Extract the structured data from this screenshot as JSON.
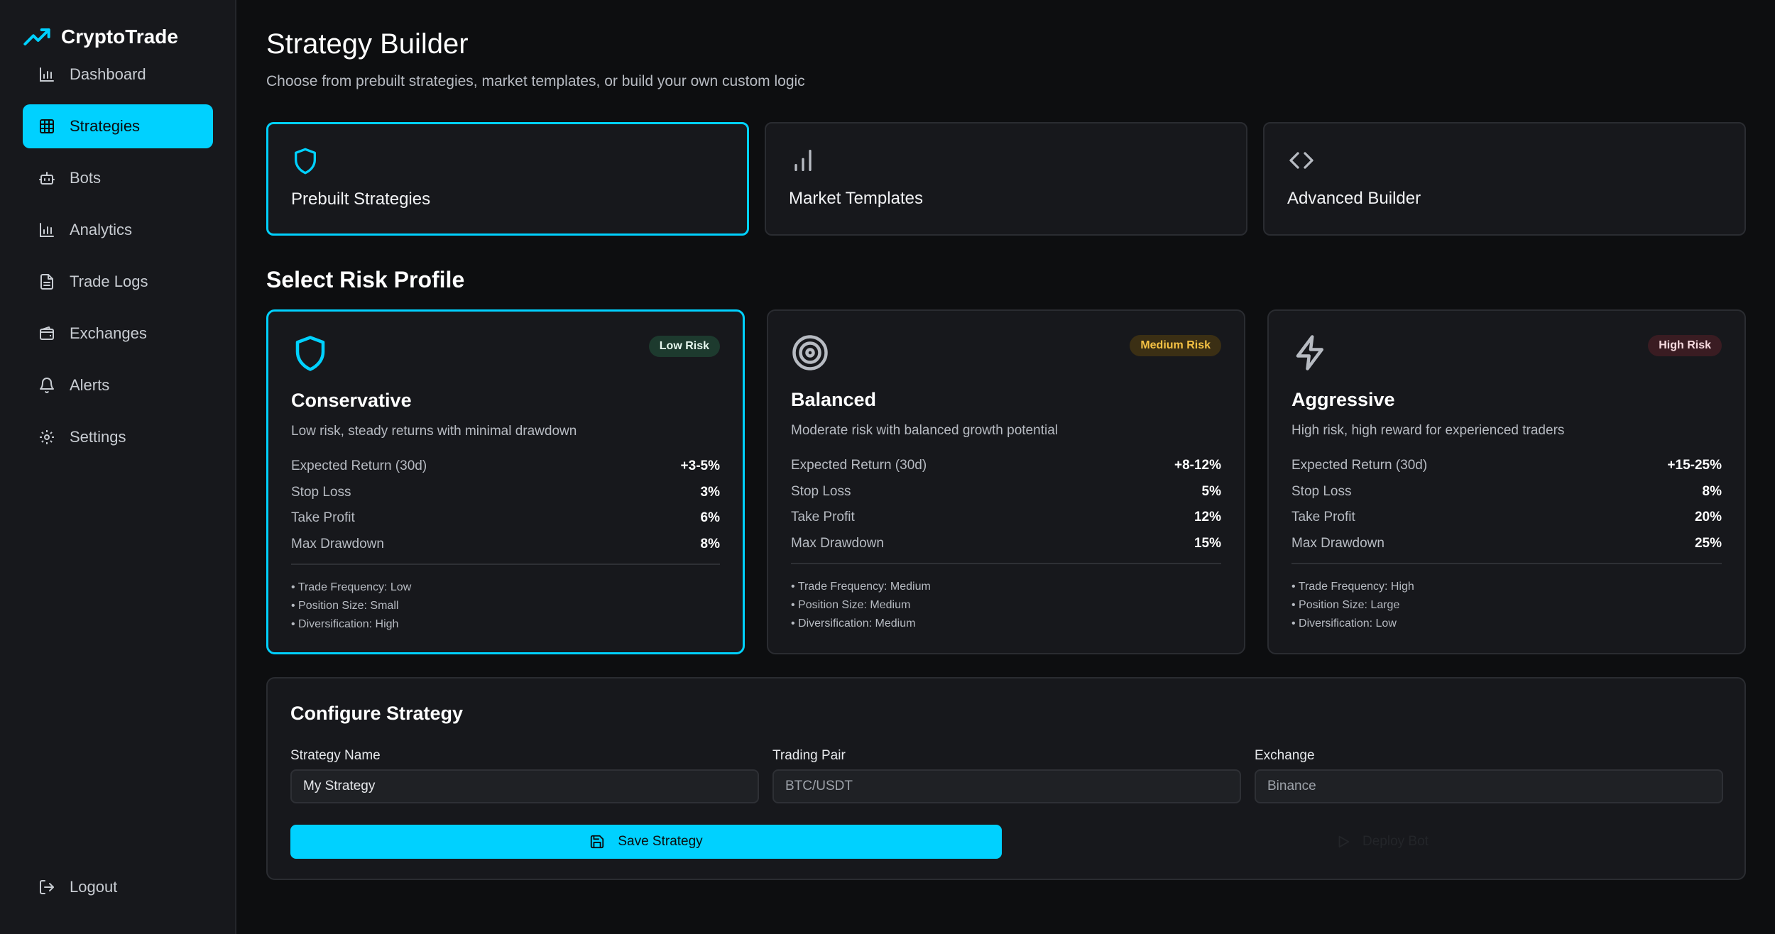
{
  "app": {
    "name": "CryptoTrade"
  },
  "sidebar": {
    "items": [
      {
        "label": "Dashboard",
        "icon": "bar-chart-icon"
      },
      {
        "label": "Strategies",
        "icon": "grid-icon",
        "active": true
      },
      {
        "label": "Bots",
        "icon": "bot-icon"
      },
      {
        "label": "Analytics",
        "icon": "bar-chart-icon"
      },
      {
        "label": "Trade Logs",
        "icon": "file-text-icon"
      },
      {
        "label": "Exchanges",
        "icon": "wallet-icon"
      },
      {
        "label": "Alerts",
        "icon": "bell-icon"
      },
      {
        "label": "Settings",
        "icon": "gear-icon"
      }
    ],
    "logout": {
      "label": "Logout",
      "icon": "logout-icon"
    }
  },
  "header": {
    "title": "Strategy Builder",
    "subtitle": "Choose from prebuilt strategies, market templates, or build your own custom logic"
  },
  "modes": [
    {
      "label": "Prebuilt Strategies",
      "icon": "shield-icon",
      "active": true
    },
    {
      "label": "Market Templates",
      "icon": "signal-bars-icon"
    },
    {
      "label": "Advanced Builder",
      "icon": "code-icon"
    }
  ],
  "risk_section": {
    "title": "Select Risk Profile"
  },
  "risk_profiles": [
    {
      "name": "Conservative",
      "badge": "Low Risk",
      "description": "Low risk, steady returns with minimal drawdown",
      "icon": "shield-icon",
      "selected": true,
      "stats": [
        {
          "label": "Expected Return (30d)",
          "value": "+3-5%"
        },
        {
          "label": "Stop Loss",
          "value": "3%"
        },
        {
          "label": "Take Profit",
          "value": "6%"
        },
        {
          "label": "Max Drawdown",
          "value": "8%"
        }
      ],
      "features": [
        "• Trade Frequency: Low",
        "• Position Size: Small",
        "• Diversification: High"
      ]
    },
    {
      "name": "Balanced",
      "badge": "Medium Risk",
      "description": "Moderate risk with balanced growth potential",
      "icon": "target-icon",
      "stats": [
        {
          "label": "Expected Return (30d)",
          "value": "+8-12%"
        },
        {
          "label": "Stop Loss",
          "value": "5%"
        },
        {
          "label": "Take Profit",
          "value": "12%"
        },
        {
          "label": "Max Drawdown",
          "value": "15%"
        }
      ],
      "features": [
        "• Trade Frequency: Medium",
        "• Position Size: Medium",
        "• Diversification: Medium"
      ]
    },
    {
      "name": "Aggressive",
      "badge": "High Risk",
      "description": "High risk, high reward for experienced traders",
      "icon": "lightning-icon",
      "stats": [
        {
          "label": "Expected Return (30d)",
          "value": "+15-25%"
        },
        {
          "label": "Stop Loss",
          "value": "8%"
        },
        {
          "label": "Take Profit",
          "value": "20%"
        },
        {
          "label": "Max Drawdown",
          "value": "25%"
        }
      ],
      "features": [
        "• Trade Frequency: High",
        "• Position Size: Large",
        "• Diversification: Low"
      ]
    }
  ],
  "config": {
    "title": "Configure Strategy",
    "strategy_name": {
      "label": "Strategy Name",
      "value": "My Strategy"
    },
    "trading_pair": {
      "label": "Trading Pair",
      "value": "BTC/USDT"
    },
    "exchange": {
      "label": "Exchange",
      "value": "Binance"
    },
    "save_label": "Save Strategy",
    "deploy_label": "Deploy Bot"
  },
  "colors": {
    "accent": "#00d1ff",
    "background": "#0d0e10",
    "surface": "#17181c",
    "low_risk": "#1d3a2e",
    "medium_risk": "#f6c244",
    "high_risk": "#3a1c22"
  }
}
